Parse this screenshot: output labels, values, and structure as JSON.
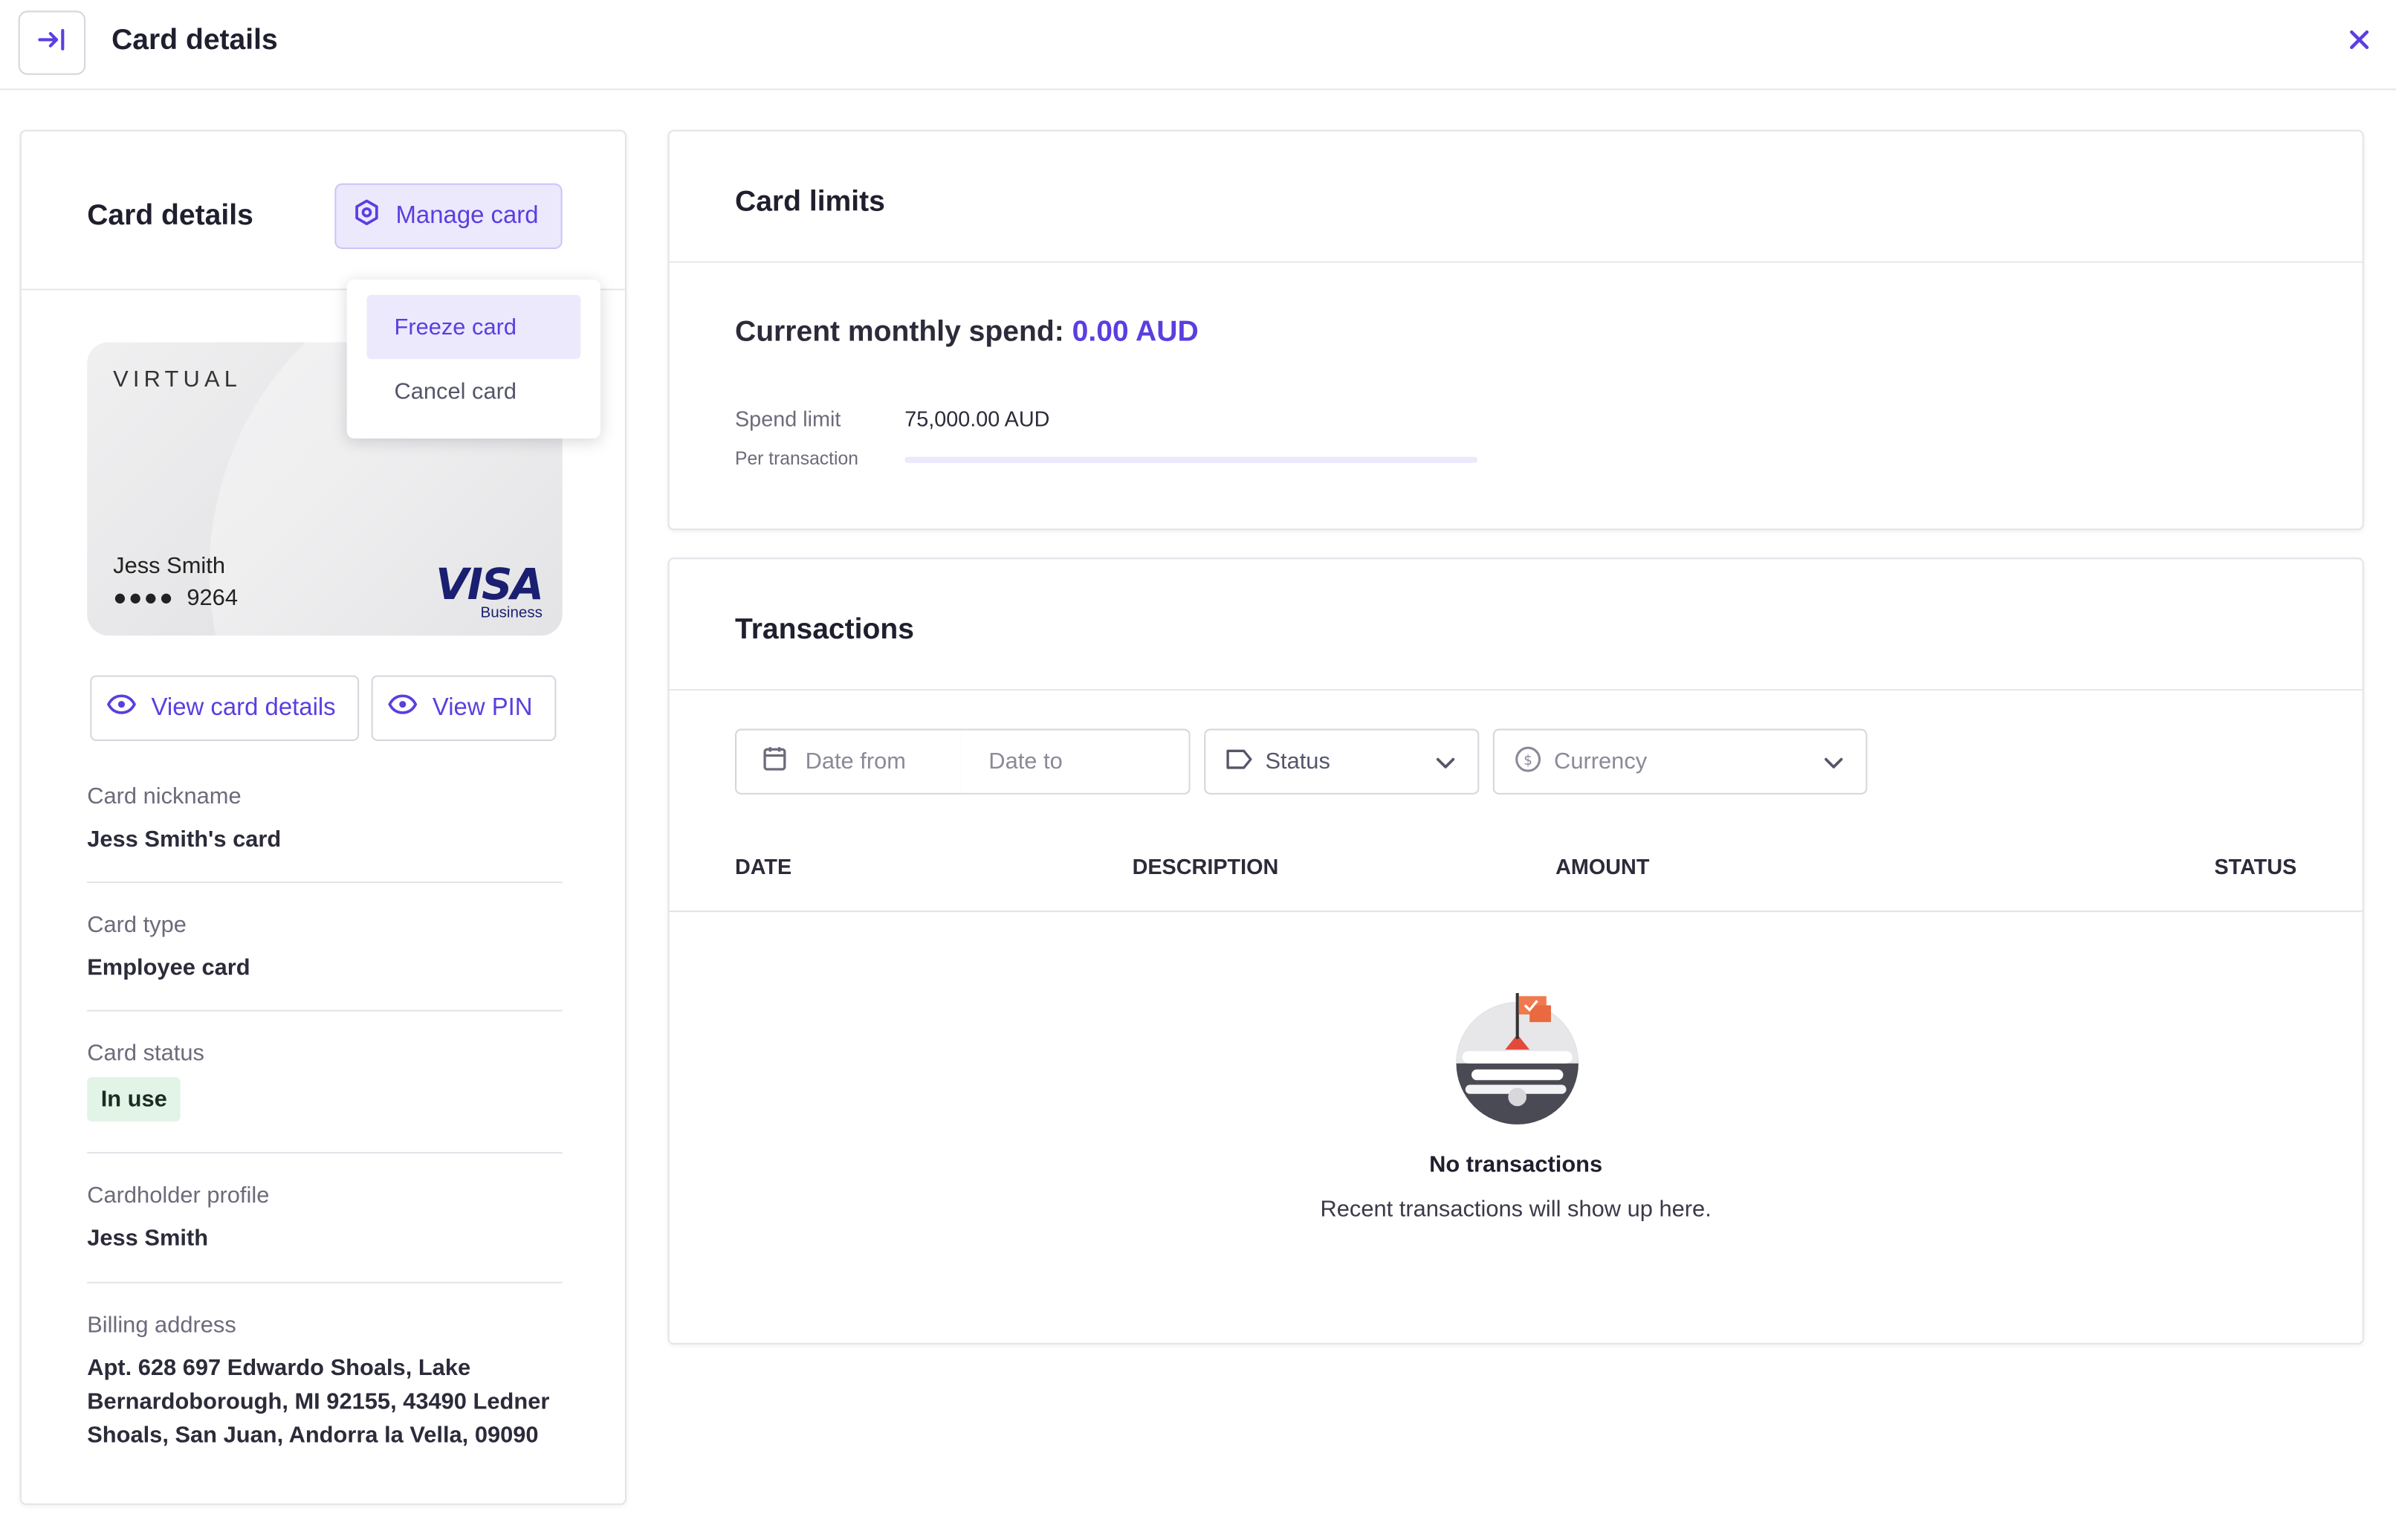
{
  "header": {
    "title": "Card details"
  },
  "left": {
    "title": "Card details",
    "manage_label": "Manage card",
    "menu": [
      {
        "label": "Freeze card",
        "active": true
      },
      {
        "label": "Cancel card",
        "active": false
      }
    ],
    "card": {
      "type": "VIRTUAL",
      "holder": "Jess Smith",
      "dots": "●●●●",
      "last4": "9264",
      "brand": "VISA",
      "brand_sub": "Business"
    },
    "view_details_label": "View card details",
    "view_pin_label": "View PIN",
    "fields": {
      "nickname": {
        "label": "Card nickname",
        "value": "Jess Smith's card"
      },
      "type": {
        "label": "Card type",
        "value": "Employee card"
      },
      "status": {
        "label": "Card status",
        "value": "In use"
      },
      "profile": {
        "label": "Cardholder profile",
        "value": "Jess Smith"
      },
      "billing": {
        "label": "Billing address",
        "value": "Apt. 628 697 Edwardo Shoals, Lake Bernardoborough, MI 92155, 43490 Ledner Shoals, San Juan, Andorra la Vella, 09090"
      }
    }
  },
  "limits": {
    "title": "Card limits",
    "spend_label": "Current monthly spend:",
    "spend_value": "0.00 AUD",
    "limit_label": "Spend limit",
    "limit_sub": "Per transaction",
    "limit_value": "75,000.00 AUD",
    "limit_used_fraction": 0
  },
  "transactions": {
    "title": "Transactions",
    "filters": {
      "date_from": "Date from",
      "date_to": "Date to",
      "status": "Status",
      "currency": "Currency"
    },
    "columns": [
      "DATE",
      "DESCRIPTION",
      "AMOUNT",
      "STATUS"
    ],
    "empty_title": "No transactions",
    "empty_sub": "Recent transactions will show up here."
  },
  "colors": {
    "accent": "#5b3ee0",
    "accent_light": "#ece9fd",
    "badge_green": "#e1f4e6"
  },
  "icons": [
    "collapse-panel-icon",
    "close-icon",
    "gear-icon",
    "eye-icon",
    "calendar-icon",
    "tag-icon",
    "currency-icon",
    "chevron-down-icon"
  ]
}
